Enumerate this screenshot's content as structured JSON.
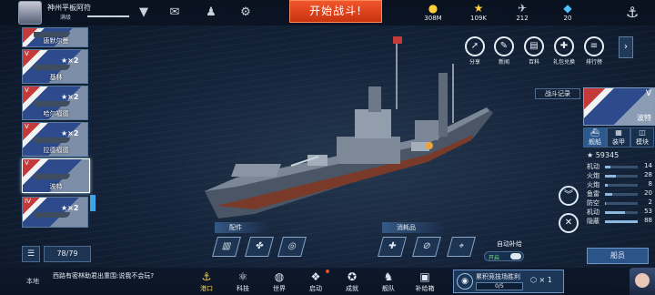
{
  "player": {
    "name": "神州平板阿符",
    "level": "满级"
  },
  "top_icons": [
    "mail-icon",
    "friends-icon",
    "settings-icon"
  ],
  "battle_button": "开始战斗!",
  "resources": [
    {
      "icon": "coin-icon",
      "value": "308M"
    },
    {
      "icon": "star-icon",
      "value": "109K"
    },
    {
      "icon": "satellite-icon",
      "value": "212"
    },
    {
      "icon": "gem-icon",
      "value": "20"
    }
  ],
  "right_buttons": [
    {
      "name": "share",
      "label": "分享",
      "icon": "share-icon"
    },
    {
      "name": "news",
      "label": "新闻",
      "icon": "news-icon"
    },
    {
      "name": "wiki",
      "label": "百科",
      "icon": "book-icon"
    },
    {
      "name": "redeem",
      "label": "礼包兑换",
      "icon": "gift-icon"
    },
    {
      "name": "ranking",
      "label": "排行榜",
      "icon": "ranking-icon"
    }
  ],
  "battle_log": "战斗记录",
  "ship_list": [
    {
      "tier": "",
      "name": "唐默尔曼",
      "count": ""
    },
    {
      "tier": "V",
      "name": "基林",
      "count": "★×2"
    },
    {
      "tier": "V",
      "name": "哈尔福德",
      "count": "★×2"
    },
    {
      "tier": "V",
      "name": "拉德福德",
      "count": "★×2"
    },
    {
      "tier": "V",
      "name": "波特",
      "count": ""
    },
    {
      "tier": "IV",
      "name": "",
      "count": "★×2"
    }
  ],
  "list_count": "78/79",
  "selected_ship": {
    "tier": "V",
    "name": "波特",
    "tabs": [
      "舰船",
      "装甲",
      "模块"
    ],
    "power": "59345",
    "stats": [
      {
        "label": "机动",
        "value": "14",
        "pct": 0.16
      },
      {
        "label": "火炮",
        "value": "28",
        "pct": 0.32
      },
      {
        "label": "火炮",
        "value": "8",
        "pct": 0.09
      },
      {
        "label": "鱼雷",
        "value": "20",
        "pct": 0.23
      },
      {
        "label": "防空",
        "value": "2",
        "pct": 0.03
      },
      {
        "label": "机动",
        "value": "53",
        "pct": 0.6
      },
      {
        "label": "隐蔽",
        "value": "88",
        "pct": 1.0
      }
    ],
    "crew_button": "船员"
  },
  "parts_label": "配件",
  "consumables_label": "消耗品",
  "auto_refill": {
    "label": "自动补给",
    "state": "开启"
  },
  "channel": "本地",
  "chat_message": "西路有密林助君出重围:说我不会玩?",
  "nav": [
    {
      "label": "港口",
      "icon": "port-icon",
      "active": true
    },
    {
      "label": "科技",
      "icon": "tech-icon",
      "active": false
    },
    {
      "label": "世界",
      "icon": "globe-icon",
      "active": false
    },
    {
      "label": "启动",
      "icon": "launch-icon",
      "active": false
    },
    {
      "label": "成就",
      "icon": "achievement-icon",
      "active": false
    },
    {
      "label": "舰队",
      "icon": "fleet-icon",
      "active": false
    },
    {
      "label": "补给箱",
      "icon": "supply-box-icon",
      "active": false
    }
  ],
  "quest": {
    "title": "累积竞技场胜利",
    "progress": "0/5",
    "reward": "× 1"
  }
}
